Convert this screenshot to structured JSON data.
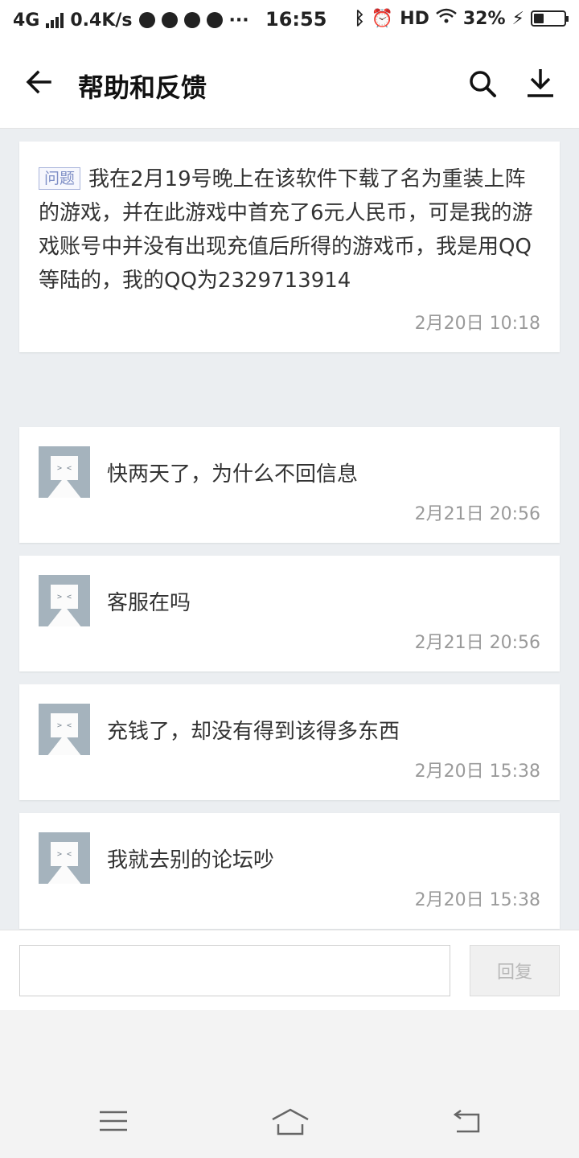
{
  "status_bar": {
    "network": "4G",
    "speed": "0.4K/s",
    "dots": "···",
    "time": "16:55",
    "hd": "HD",
    "battery": "32%",
    "battery_level": 0.32
  },
  "header": {
    "title": "帮助和反馈",
    "back_icon": "arrow-left-icon",
    "search_icon": "search-icon",
    "download_icon": "download-icon"
  },
  "question": {
    "tag": "问题",
    "text": "我在2月19号晚上在该软件下载了名为重装上阵的游戏，并在此游戏中首充了6元人民币，可是我的游戏账号中并没有出现充值后所得的游戏币，我是用QQ等陆的，我的QQ为2329713914",
    "time": "2月20日 10:18"
  },
  "messages": [
    {
      "text": "快两天了，为什么不回信息",
      "time": "2月21日 20:56"
    },
    {
      "text": "客服在吗",
      "time": "2月21日 20:56"
    },
    {
      "text": "充钱了，却没有得到该得多东西",
      "time": "2月20日 15:38"
    },
    {
      "text": "我就去别的论坛吵",
      "time": "2月20日 15:38"
    }
  ],
  "reply": {
    "input_value": "",
    "button_label": "回复"
  },
  "nav": {
    "menu_icon": "menu-icon",
    "home_icon": "home-icon",
    "back_icon": "back-icon"
  },
  "colors": {
    "content_bg": "#ebeef1",
    "tag_color": "#7f8fc6",
    "avatar_bg": "#a5b3bd"
  }
}
